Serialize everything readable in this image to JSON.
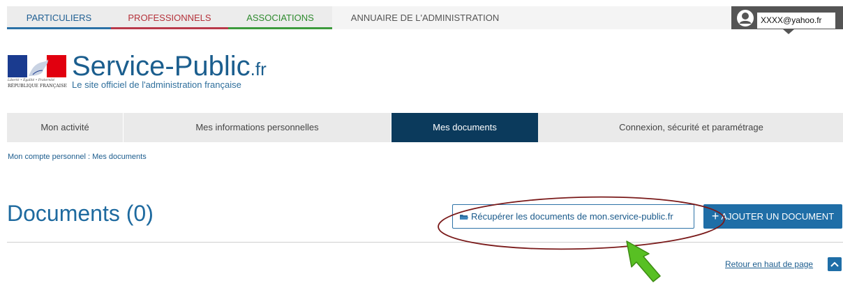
{
  "topnav": {
    "tabs": [
      {
        "label": "PARTICULIERS"
      },
      {
        "label": "PROFESSIONNELS"
      },
      {
        "label": "ASSOCIATIONS"
      },
      {
        "label": "ANNUAIRE DE L'ADMINISTRATION"
      }
    ],
    "user_email": "XXXX@yahoo.fr",
    "colors": {
      "particuliers": "#2b71a6",
      "professionnels": "#b8394a",
      "associations": "#3c9a3c"
    }
  },
  "logo": {
    "motto": "Liberté • Égalité • Fraternité",
    "republique": "RÉPUBLIQUE FRANÇAISE",
    "name": "Service-Public",
    "name_ext": ".fr",
    "tagline": "Le site officiel de l'administration française"
  },
  "account_nav": {
    "items": [
      {
        "label": "Mon activité"
      },
      {
        "label": "Mes informations personnelles"
      },
      {
        "label": "Mes documents"
      },
      {
        "label": "Connexion, sécurité et paramétrage"
      }
    ],
    "active_color": "#0b3a5c"
  },
  "breadcrumb": {
    "root": "Mon compte personnel",
    "separator": " : ",
    "current": "Mes documents"
  },
  "main": {
    "title": "Documents (0)",
    "recover_button": "Récupérer les documents de mon.service-public.fr",
    "add_button": "AJOUTER UN DOCUMENT",
    "back_to_top": "Retour en haut de page"
  },
  "icons": [
    "user-icon",
    "folder-icon",
    "plus-icon",
    "chevron-up-icon",
    "marianne-flag-icon"
  ]
}
